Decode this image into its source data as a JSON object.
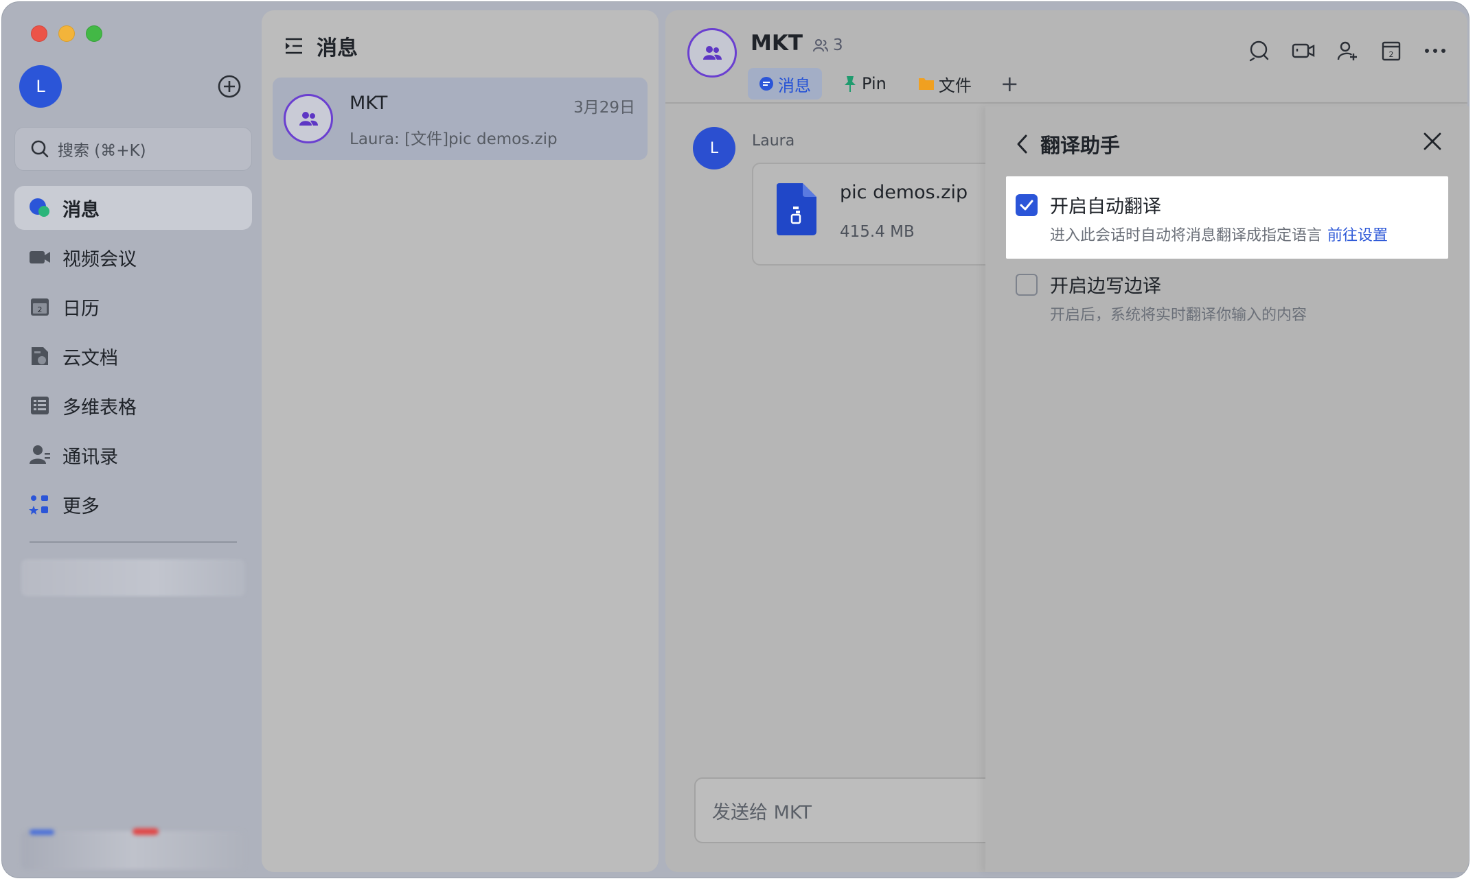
{
  "sidebar": {
    "avatar_initial": "L",
    "search_placeholder": "搜索 (⌘+K)",
    "nav": [
      {
        "label": "消息"
      },
      {
        "label": "视频会议"
      },
      {
        "label": "日历"
      },
      {
        "label": "云文档"
      },
      {
        "label": "多维表格"
      },
      {
        "label": "通讯录"
      },
      {
        "label": "更多"
      }
    ]
  },
  "chatlist": {
    "title": "消息",
    "items": [
      {
        "name": "MKT",
        "time": "3月29日",
        "preview": "Laura: [文件]pic demos.zip"
      }
    ]
  },
  "conversation": {
    "title": "MKT",
    "member_count": "3",
    "tabs": [
      {
        "label": "消息"
      },
      {
        "label": "Pin"
      },
      {
        "label": "文件"
      }
    ],
    "tab_add": "+",
    "message": {
      "sender_initial": "L",
      "sender": "Laura",
      "file_name": "pic demos.zip",
      "file_size": "415.4 MB"
    },
    "input_placeholder": "发送给 MKT"
  },
  "translate_panel": {
    "title": "翻译助手",
    "options": [
      {
        "title": "开启自动翻译",
        "desc": "进入此会话时自动将消息翻译成指定语言",
        "link": "前往设置",
        "checked": true
      },
      {
        "title": "开启边写边译",
        "desc": "开启后，系统将实时翻译你输入的内容",
        "checked": false
      }
    ]
  },
  "colors": {
    "accent": "#2b55d8",
    "group_avatar_border": "#6a3fd0",
    "traffic_red": "#ec5448",
    "traffic_yellow": "#f3b43a",
    "traffic_green": "#43b846"
  }
}
